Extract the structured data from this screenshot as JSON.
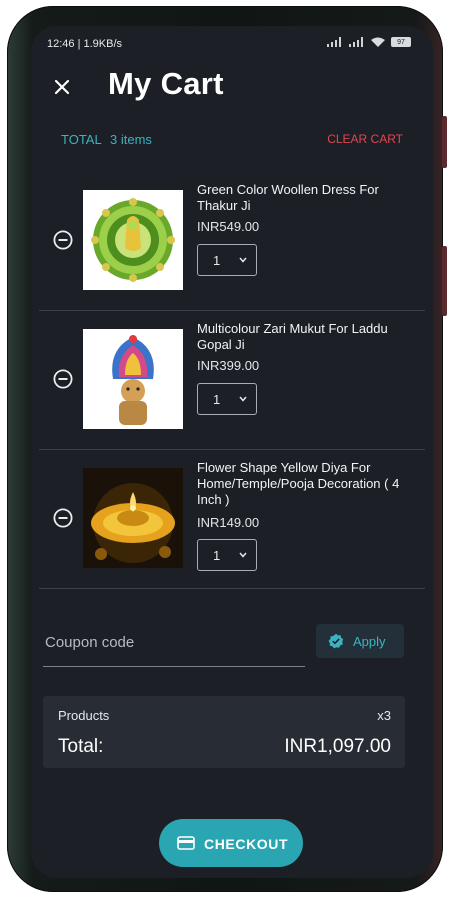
{
  "status_bar": {
    "time_speed": "12:46 | 1.9KB/s",
    "battery": "97"
  },
  "header": {
    "title": "My Cart",
    "close_icon": "close-icon"
  },
  "summary": {
    "total_label": "TOTAL",
    "item_count": "3 items",
    "clear_cart_label": "CLEAR CART"
  },
  "cart": {
    "items": [
      {
        "title": "Green Color Woollen Dress For Thakur Ji",
        "price": "INR549.00",
        "quantity": "1",
        "image": "green woollen dress thumbnail"
      },
      {
        "title": "Multicolour Zari Mukut For Laddu Gopal Ji",
        "price": "INR399.00",
        "quantity": "1",
        "image": "zari mukut thumbnail"
      },
      {
        "title": "Flower Shape Yellow Diya For Home/Temple/Pooja Decoration ( 4 Inch )",
        "price": "INR149.00",
        "quantity": "1",
        "image": "yellow diya thumbnail"
      }
    ]
  },
  "coupon": {
    "placeholder": "Coupon code",
    "value": "",
    "apply_label": "Apply"
  },
  "totals": {
    "products_label": "Products",
    "products_count": "x3",
    "total_label": "Total:",
    "total_amount": "INR1,097.00"
  },
  "checkout": {
    "label": "CHECKOUT"
  },
  "colors": {
    "background": "#1c1f26",
    "accent": "#2aa6b2",
    "danger": "#e0474f",
    "card": "#272c35"
  }
}
